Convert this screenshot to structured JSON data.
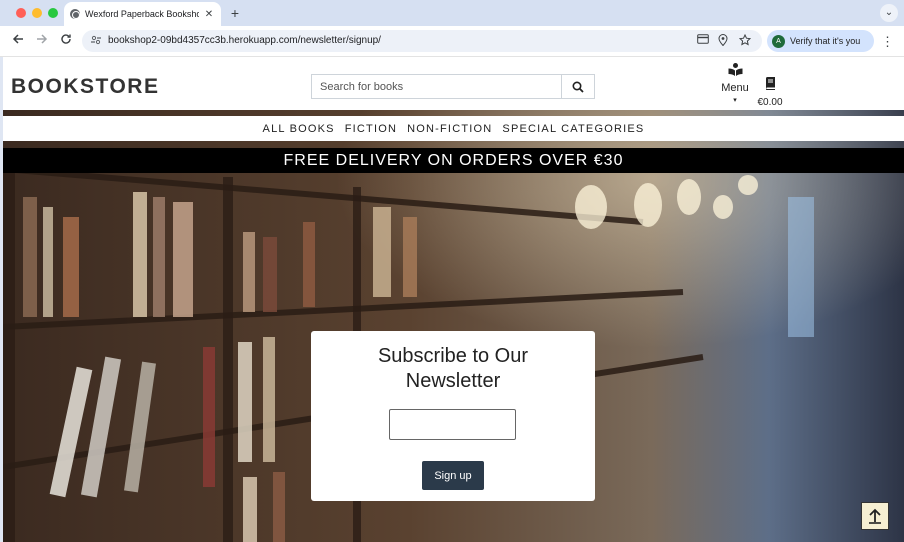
{
  "browser": {
    "tab_title": "Wexford Paperback Bookshop",
    "tab_close": "✕",
    "new_tab": "+",
    "tab_menu": "⌄",
    "url": "bookshop2-09bd4357cc3b.herokuapp.com/newsletter/signup/",
    "verify_label": "Verify that it's you",
    "verify_avatar_letter": "A",
    "nav_icons": [
      "arrow-left-icon",
      "arrow-right-icon",
      "reload-icon"
    ],
    "omnibox_icons": [
      "site-info-icon",
      "card-icon",
      "location-pin-icon",
      "bookmark-star-icon"
    ]
  },
  "header": {
    "logo": "BOOKSTORE",
    "search_placeholder": "Search for books",
    "menu_label": "Menu",
    "menu_caret": "▾",
    "cart_total": "€0.00"
  },
  "nav": {
    "items": [
      "ALL BOOKS",
      "FICTION",
      "NON-FICTION",
      "SPECIAL CATEGORIES"
    ]
  },
  "banner": {
    "text": "FREE DELIVERY ON ORDERS OVER €30"
  },
  "newsletter": {
    "title": "Subscribe to Our Newsletter",
    "email_value": "",
    "button_label": "Sign up"
  },
  "colors": {
    "banner_bg": "#000000",
    "button_bg": "#2b3a4a",
    "back_to_top_bg": "#f6efd2"
  }
}
